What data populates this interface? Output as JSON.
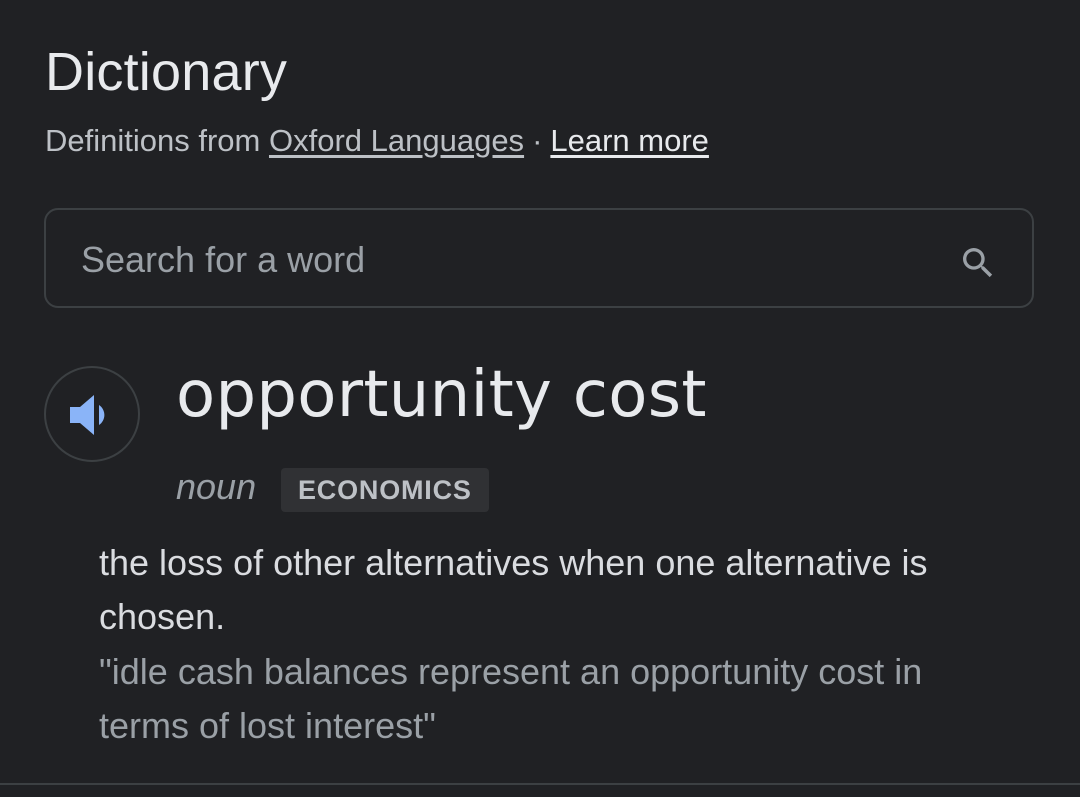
{
  "header": {
    "title": "Dictionary",
    "source_prefix": "Definitions from",
    "source_link": "Oxford Languages",
    "separator": "·",
    "learn_more": "Learn more"
  },
  "search": {
    "placeholder": "Search for a word",
    "icon": "search-icon"
  },
  "entry": {
    "speaker_icon": "speaker-icon",
    "word": "opportunity cost",
    "part_of_speech": "noun",
    "label": "ECONOMICS",
    "definition": "the loss of other alternatives when one alternative is chosen.",
    "example": "\"idle cash balances represent an opportunity cost in terms of lost interest\""
  },
  "colors": {
    "background": "#202124",
    "accent_speaker": "#8ab4f8",
    "text_primary": "#e8eaed",
    "text_secondary": "#9aa0a6"
  }
}
